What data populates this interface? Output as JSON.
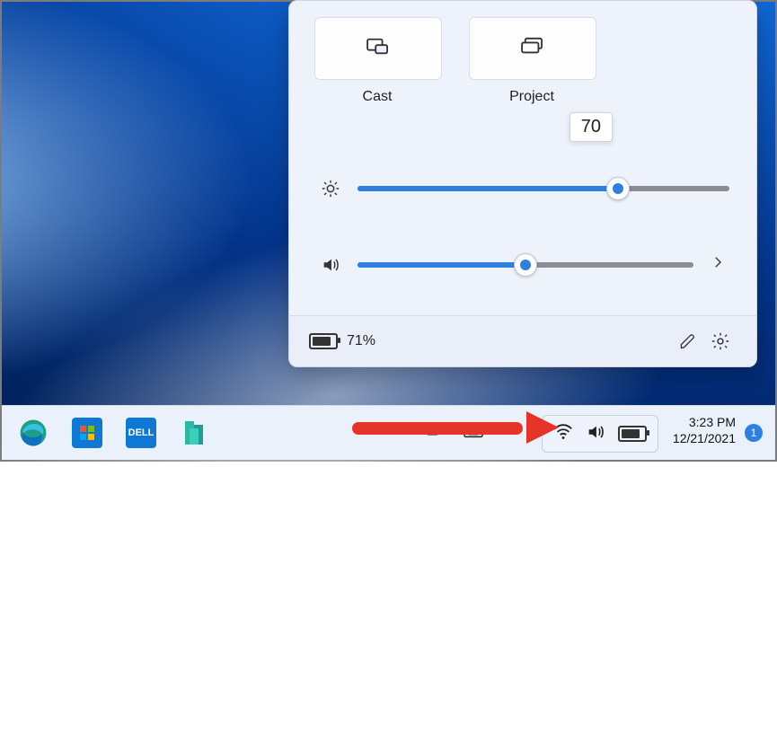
{
  "panel": {
    "tiles": [
      {
        "label": "Cast",
        "icon": "cast-icon"
      },
      {
        "label": "Project",
        "icon": "project-icon"
      }
    ],
    "brightness": {
      "value": 70,
      "tooltip": "70"
    },
    "volume": {
      "value": 50
    },
    "battery_percent": "71%"
  },
  "taskbar": {
    "time": "3:23 PM",
    "date": "12/21/2021",
    "notification_count": "1"
  },
  "colors": {
    "accent": "#2f7fe0",
    "arrow": "#e53327"
  }
}
